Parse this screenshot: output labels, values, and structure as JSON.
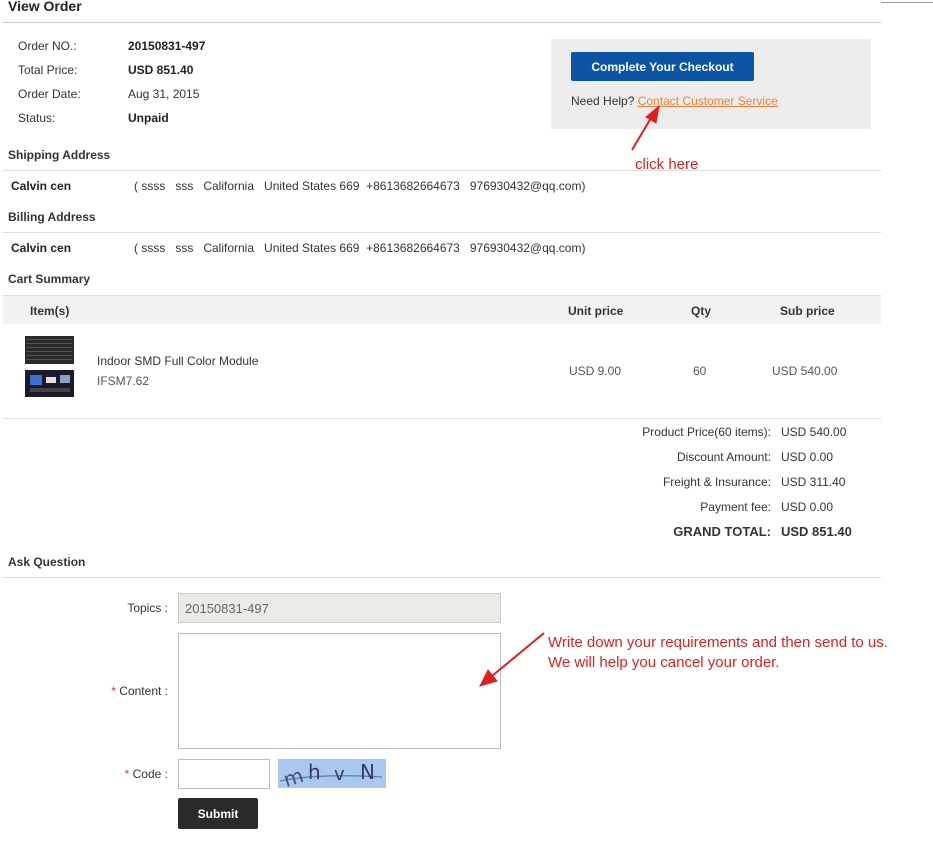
{
  "page": {
    "title": "View Order"
  },
  "order_info": [
    {
      "label": "Order NO.:",
      "value": "20150831-497"
    },
    {
      "label": "Total Price:",
      "value": "USD 851.40"
    },
    {
      "label": "Order Date:",
      "value": "Aug 31, 2015"
    },
    {
      "label": "Status:",
      "value": "Unpaid"
    }
  ],
  "checkout": {
    "button_label": "Complete Your Checkout",
    "help_text": "Need Help?",
    "link_text": "Contact Customer Service"
  },
  "annotations": {
    "click_here": "click here",
    "instruction_line1": "Write down your requirements and then send to us.",
    "instruction_line2": "We will help you cancel your order."
  },
  "shipping": {
    "title": "Shipping Address",
    "name": "Calvin cen",
    "address": "( ssss   sss   California   United States 669  +8613682664673   976930432@qq.com)"
  },
  "billing": {
    "title": "Billing Address",
    "name": "Calvin cen",
    "address": "( ssss   sss   California   United States 669  +8613682664673   976930432@qq.com)"
  },
  "cart": {
    "title": "Cart Summary",
    "headers": {
      "item": "Item(s)",
      "unit_price": "Unit price",
      "qty": "Qty",
      "sub_price": "Sub price"
    },
    "items": [
      {
        "name": "Indoor SMD Full Color Module",
        "sku": "IFSM7.62",
        "unit_price": "USD 9.00",
        "qty": "60",
        "sub_price": "USD 540.00"
      }
    ]
  },
  "summary": {
    "product_price_label": "Product Price(60 items):",
    "product_price": "USD 540.00",
    "discount_label": "Discount Amount:",
    "discount": "USD 0.00",
    "freight_label": "Freight & Insurance:",
    "freight": "USD 311.40",
    "payment_fee_label": "Payment fee:",
    "payment_fee": "USD 0.00",
    "grand_total_label": "GRAND TOTAL:",
    "grand_total": "USD 851.40"
  },
  "ask_question": {
    "title": "Ask Question",
    "topics_label": "Topics :",
    "topics_value": "20150831-497",
    "required_mark": "*",
    "content_label": "Content :",
    "code_label": "Code :",
    "captcha_text": "mhvN",
    "submit_label": "Submit"
  },
  "colors": {
    "primary_button": "#0b55a4",
    "link": "#f08040",
    "annotation": "#e02020",
    "submit_button": "#2b2b2b"
  }
}
